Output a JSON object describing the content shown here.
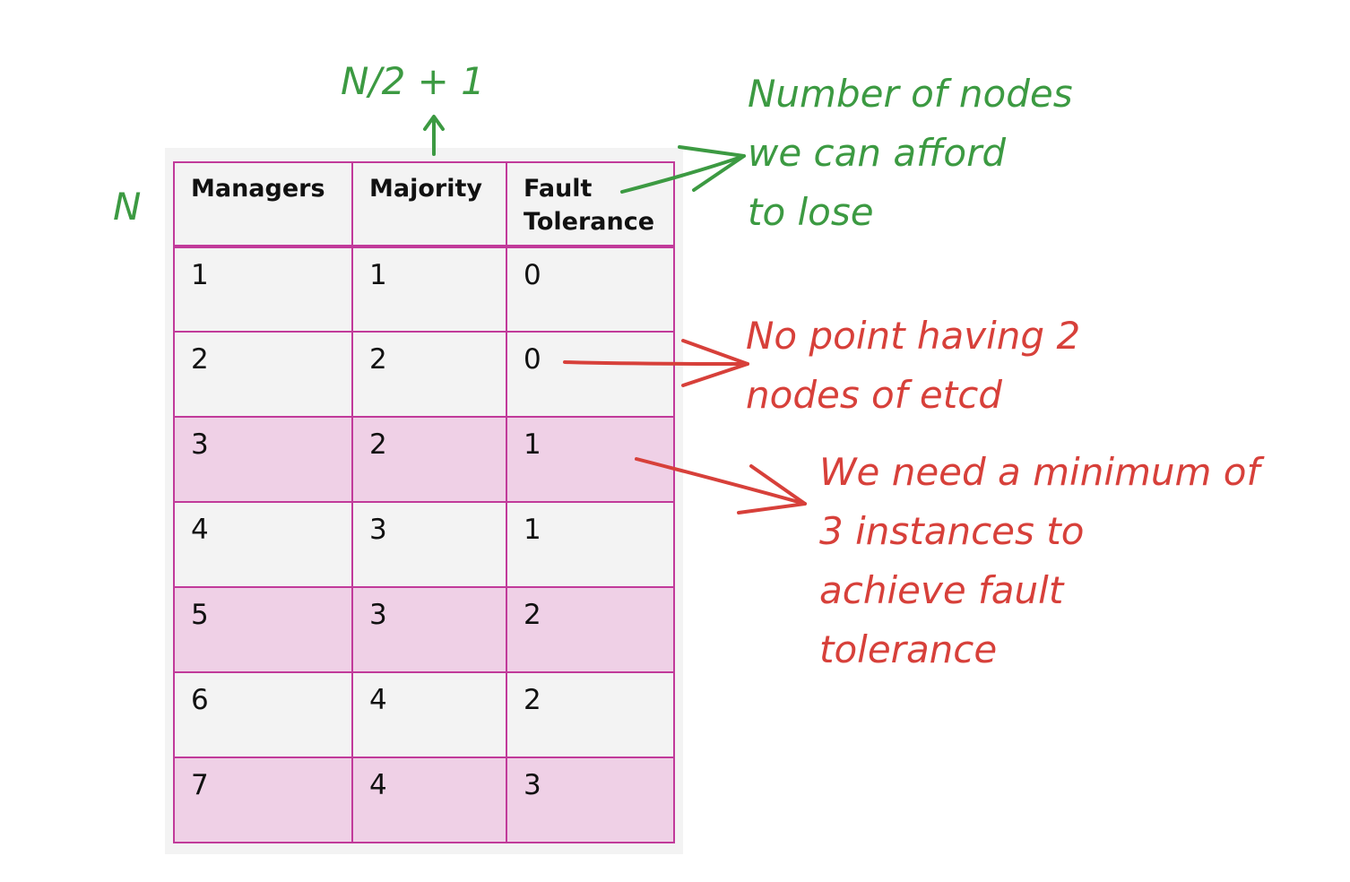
{
  "table": {
    "headers": [
      "Managers",
      "Majority",
      "Fault\nTolerance"
    ],
    "rows": [
      [
        "1",
        "1",
        "0"
      ],
      [
        "2",
        "2",
        "0"
      ],
      [
        "3",
        "2",
        "1"
      ],
      [
        "4",
        "3",
        "1"
      ],
      [
        "5",
        "3",
        "2"
      ],
      [
        "6",
        "4",
        "2"
      ],
      [
        "7",
        "4",
        "3"
      ]
    ],
    "shaded_rows": [
      false,
      false,
      true,
      false,
      true,
      false,
      true
    ]
  },
  "annotations": {
    "majority_formula": "N/2 + 1",
    "managers_symbol": "N",
    "fault_tolerance_note": [
      "Number of nodes",
      "we can afford",
      "to lose"
    ],
    "two_nodes_note": [
      "No point having 2",
      "nodes of etcd"
    ],
    "minimum_note": [
      "We need a minimum of",
      "3 instances to",
      "achieve fault",
      "tolerance"
    ]
  },
  "colors": {
    "border": "#c13a9a",
    "shaded_row": "#efd0e6",
    "panel": "#f3f3f3",
    "green_annotation": "#3c9a42",
    "red_annotation": "#d7403a"
  }
}
